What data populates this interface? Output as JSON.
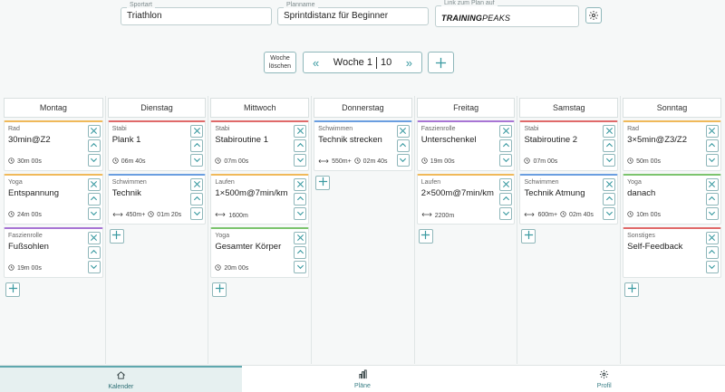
{
  "top": {
    "sport": {
      "label": "Sportart",
      "value": "Triathlon"
    },
    "plan": {
      "label": "Planname",
      "value": "Sprintdistanz für Beginner"
    },
    "link": {
      "label": "Link zum Plan auf",
      "brand_a": "TRAINING",
      "brand_b": "PEAKS"
    }
  },
  "week": {
    "delete_line1": "Woche",
    "delete_line2": "löschen",
    "current": "Woche 1",
    "total": "10"
  },
  "days": [
    {
      "name": "Montag",
      "cards": [
        {
          "category": "Rad",
          "title": "30min@Z2",
          "meta": "30m 00s",
          "metric": "",
          "color": "orange"
        },
        {
          "category": "Yoga",
          "title": "Entspannung",
          "meta": "24m 00s",
          "metric": "",
          "color": "orange"
        },
        {
          "category": "Faszienrolle",
          "title": "Fußsohlen",
          "meta": "19m 00s",
          "metric": "",
          "color": "purple"
        }
      ]
    },
    {
      "name": "Dienstag",
      "cards": [
        {
          "category": "Stabi",
          "title": "Plank 1",
          "meta": "06m 40s",
          "metric": "",
          "color": "red"
        },
        {
          "category": "Schwimmen",
          "title": "Technik",
          "meta": "01m 20s",
          "metric": "450m+",
          "color": "blue"
        }
      ]
    },
    {
      "name": "Mittwoch",
      "cards": [
        {
          "category": "Stabi",
          "title": "Stabiroutine 1",
          "meta": "07m 00s",
          "metric": "",
          "color": "red"
        },
        {
          "category": "Laufen",
          "title": "1×500m@7min/km",
          "meta": "",
          "metric": "1600m",
          "color": "orange"
        },
        {
          "category": "Yoga",
          "title": "Gesamter Körper",
          "meta": "20m 00s",
          "metric": "",
          "color": "green"
        }
      ]
    },
    {
      "name": "Donnerstag",
      "cards": [
        {
          "category": "Schwimmen",
          "title": "Technik strecken",
          "meta": "02m 40s",
          "metric": "550m+",
          "color": "blue"
        }
      ]
    },
    {
      "name": "Freitag",
      "cards": [
        {
          "category": "Faszienrolle",
          "title": "Unterschenkel",
          "meta": "19m 00s",
          "metric": "",
          "color": "purple"
        },
        {
          "category": "Laufen",
          "title": "2×500m@7min/km",
          "meta": "",
          "metric": "2200m",
          "color": "orange"
        }
      ]
    },
    {
      "name": "Samstag",
      "cards": [
        {
          "category": "Stabi",
          "title": "Stabiroutine 2",
          "meta": "07m 00s",
          "metric": "",
          "color": "red"
        },
        {
          "category": "Schwimmen",
          "title": "Technik Atmung",
          "meta": "02m 40s",
          "metric": "600m+",
          "color": "blue"
        }
      ]
    },
    {
      "name": "Sonntag",
      "cards": [
        {
          "category": "Rad",
          "title": "3×5min@Z3/Z2",
          "meta": "50m 00s",
          "metric": "",
          "color": "orange"
        },
        {
          "category": "Yoga",
          "title": "danach",
          "meta": "10m 00s",
          "metric": "",
          "color": "green"
        },
        {
          "category": "Sonstiges",
          "title": "Self-Feedback",
          "meta": "",
          "metric": "",
          "color": "red"
        }
      ]
    }
  ],
  "nav": [
    {
      "label": "Kalender",
      "icon": "home-icon",
      "active": true
    },
    {
      "label": "Pläne",
      "icon": "bar-chart-icon",
      "active": false
    },
    {
      "label": "Profil",
      "icon": "gear-icon",
      "active": false
    }
  ],
  "colors": {
    "accent": "#3a9aa1",
    "orange": "#f0b95a",
    "red": "#e06a6a",
    "blue": "#6a9ee0",
    "purple": "#a875d4",
    "green": "#7cc46e"
  }
}
